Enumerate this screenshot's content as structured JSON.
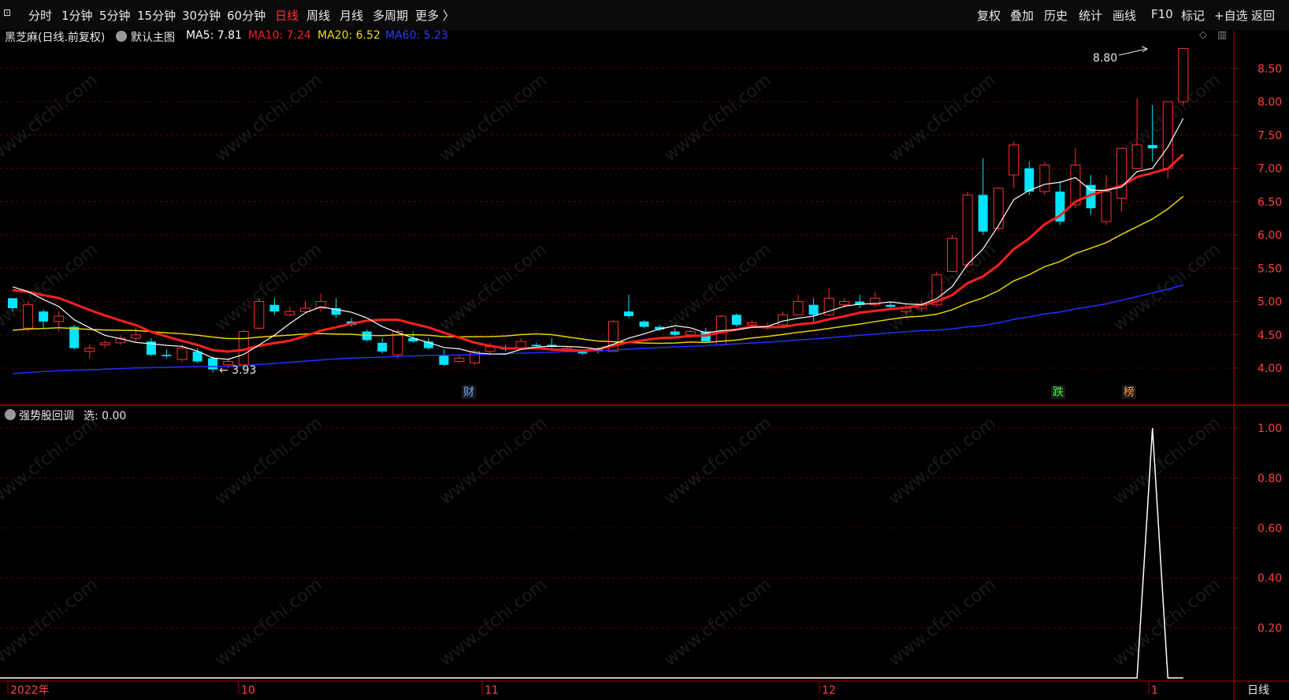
{
  "toolbar": {
    "period_tabs": [
      "分时",
      "1分钟",
      "5分钟",
      "15分钟",
      "30分钟",
      "60分钟",
      "日线",
      "周线",
      "月线",
      "多周期",
      "更多 〉"
    ],
    "active_tab": "日线",
    "right_buttons": [
      "复权",
      "叠加",
      "历史",
      "统计",
      "画线",
      "F10",
      "标记",
      "+自选",
      "返回"
    ]
  },
  "main_chart": {
    "title": "黑芝麻(日线.前复权)",
    "template": "默认主图",
    "ma": [
      {
        "label": "MA5: 7.81",
        "color": "#ffffff"
      },
      {
        "label": "MA10: 7.24",
        "color": "#ff2020"
      },
      {
        "label": "MA20: 6.52",
        "color": "#f0e000"
      },
      {
        "label": "MA60: 5.23",
        "color": "#2040ff"
      }
    ],
    "price_ticks": [
      "8.50",
      "8.00",
      "7.50",
      "7.00",
      "6.50",
      "6.00",
      "5.50",
      "5.00",
      "4.50",
      "4.00"
    ],
    "high_label": "8.80",
    "low_label": "3.93",
    "markers": [
      {
        "text": "财",
        "color": "#6fa8ff"
      },
      {
        "text": "跌",
        "color": "#40ff40"
      },
      {
        "text": "榜",
        "color": "#ff9a40"
      }
    ]
  },
  "indicator": {
    "name": "强势股回调",
    "value_label": "选: 0.00",
    "ticks": [
      "1.00",
      "0.80",
      "0.60",
      "0.40",
      "0.20"
    ]
  },
  "date_axis": {
    "labels": [
      "2022年",
      "10",
      "11",
      "12",
      "1"
    ],
    "period_label": "日线"
  },
  "watermark": "www.cfchi.com",
  "colors": {
    "up": "#ff3030",
    "down": "#00e5ff",
    "ma5": "#ffffff",
    "ma10": "#ff2020",
    "ma20": "#e8d400",
    "ma60": "#2030ff",
    "grid": "#5a0000"
  },
  "chart_data": {
    "type": "candlestick",
    "ylim": [
      3.8,
      8.9
    ],
    "candles": [
      [
        5.05,
        4.9,
        5.05,
        4.85
      ],
      [
        4.6,
        4.95,
        5.0,
        4.55
      ],
      [
        4.85,
        4.7,
        4.88,
        4.6
      ],
      [
        4.7,
        4.78,
        4.85,
        4.55
      ],
      [
        4.62,
        4.3,
        4.65,
        4.28
      ],
      [
        4.25,
        4.3,
        4.35,
        4.15
      ],
      [
        4.35,
        4.38,
        4.42,
        4.3
      ],
      [
        4.38,
        4.45,
        4.5,
        4.35
      ],
      [
        4.45,
        4.5,
        4.6,
        4.4
      ],
      [
        4.4,
        4.2,
        4.45,
        4.18
      ],
      [
        4.2,
        4.18,
        4.28,
        4.15
      ],
      [
        4.13,
        4.3,
        4.35,
        4.1
      ],
      [
        4.25,
        4.1,
        4.3,
        4.08
      ],
      [
        4.15,
        3.98,
        4.18,
        3.93
      ],
      [
        4.05,
        4.1,
        4.15,
        4.0
      ],
      [
        4.05,
        4.55,
        4.58,
        4.02
      ],
      [
        4.6,
        5.0,
        5.05,
        4.58
      ],
      [
        4.95,
        4.85,
        5.05,
        4.8
      ],
      [
        4.8,
        4.85,
        4.92,
        4.78
      ],
      [
        4.85,
        4.9,
        5.0,
        4.82
      ],
      [
        4.9,
        5.0,
        5.12,
        4.85
      ],
      [
        4.9,
        4.8,
        5.05,
        4.75
      ],
      [
        4.7,
        4.65,
        4.75,
        4.62
      ],
      [
        4.55,
        4.42,
        4.58,
        4.4
      ],
      [
        4.38,
        4.25,
        4.45,
        4.22
      ],
      [
        4.2,
        4.55,
        4.58,
        4.15
      ],
      [
        4.45,
        4.4,
        4.55,
        4.38
      ],
      [
        4.4,
        4.3,
        4.45,
        4.28
      ],
      [
        4.2,
        4.05,
        4.28,
        4.03
      ],
      [
        4.1,
        4.15,
        4.2,
        4.08
      ],
      [
        4.08,
        4.25,
        4.28,
        4.05
      ],
      [
        4.25,
        4.32,
        4.38,
        4.22
      ],
      [
        4.3,
        4.28,
        4.35,
        4.25
      ],
      [
        4.3,
        4.4,
        4.45,
        4.28
      ],
      [
        4.35,
        4.33,
        4.38,
        4.3
      ],
      [
        4.35,
        4.32,
        4.45,
        4.3
      ],
      [
        4.3,
        4.3,
        4.33,
        4.25
      ],
      [
        4.25,
        4.22,
        4.28,
        4.2
      ],
      [
        4.28,
        4.25,
        4.32,
        4.22
      ],
      [
        4.25,
        4.7,
        4.72,
        4.25
      ],
      [
        4.85,
        4.78,
        5.1,
        4.75
      ],
      [
        4.7,
        4.62,
        4.72,
        4.6
      ],
      [
        4.62,
        4.58,
        4.65,
        4.55
      ],
      [
        4.55,
        4.5,
        4.6,
        4.48
      ],
      [
        4.5,
        4.55,
        4.58,
        4.45
      ],
      [
        4.55,
        4.4,
        4.6,
        4.38
      ],
      [
        4.35,
        4.78,
        4.8,
        4.33
      ],
      [
        4.8,
        4.65,
        4.82,
        4.62
      ],
      [
        4.65,
        4.68,
        4.72,
        4.6
      ],
      [
        4.62,
        4.62,
        4.68,
        4.58
      ],
      [
        4.65,
        4.8,
        4.85,
        4.6
      ],
      [
        4.8,
        5.0,
        5.1,
        4.8
      ],
      [
        4.95,
        4.8,
        5.05,
        4.7
      ],
      [
        4.8,
        5.05,
        5.2,
        4.78
      ],
      [
        4.95,
        5.0,
        5.05,
        4.9
      ],
      [
        5.0,
        4.95,
        5.1,
        4.9
      ],
      [
        4.95,
        5.05,
        5.15,
        4.92
      ],
      [
        4.95,
        4.92,
        5.0,
        4.9
      ],
      [
        4.85,
        4.9,
        4.98,
        4.8
      ],
      [
        4.9,
        4.95,
        5.0,
        4.85
      ],
      [
        4.95,
        5.4,
        5.45,
        4.92
      ],
      [
        5.45,
        5.95,
        6.0,
        5.45
      ],
      [
        5.55,
        6.6,
        6.65,
        5.5
      ],
      [
        6.6,
        6.05,
        7.15,
        6.0
      ],
      [
        6.1,
        6.7,
        6.72,
        6.05
      ],
      [
        6.9,
        7.35,
        7.4,
        6.7
      ],
      [
        7.0,
        6.65,
        7.1,
        6.6
      ],
      [
        6.65,
        7.05,
        7.1,
        6.6
      ],
      [
        6.65,
        6.2,
        6.8,
        6.15
      ],
      [
        6.45,
        7.05,
        7.3,
        6.4
      ],
      [
        6.75,
        6.4,
        6.9,
        6.3
      ],
      [
        6.2,
        6.65,
        6.9,
        6.15
      ],
      [
        6.55,
        7.3,
        7.3,
        6.35
      ],
      [
        7.0,
        7.35,
        8.05,
        7.0
      ],
      [
        7.35,
        7.3,
        7.95,
        7.1
      ],
      [
        7.0,
        8.0,
        8.0,
        6.85
      ],
      [
        8.0,
        8.8,
        8.8,
        7.95
      ]
    ],
    "ma5_end": 7.81,
    "ma10_end": 7.24,
    "ma20_end": 6.52,
    "ma60_end": 5.23,
    "indicator_series": {
      "name": "选",
      "ylim": [
        0,
        1.05
      ],
      "spike_index": 74,
      "spike_value": 1.0
    }
  }
}
